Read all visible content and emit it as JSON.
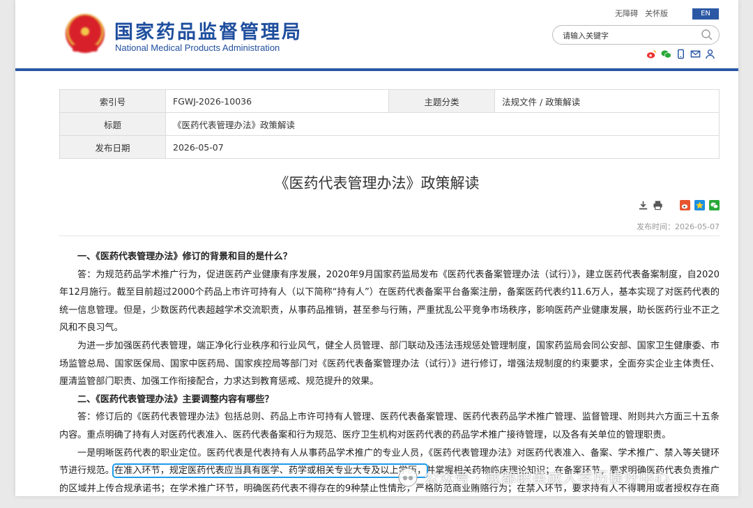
{
  "header": {
    "site_name_cn": "国家药品监督管理局",
    "site_name_en": "National Medical Products Administration",
    "top_links": [
      "无障碍",
      "关怀版"
    ],
    "top_button": "EN",
    "search_placeholder": "请输入关键字"
  },
  "meta": {
    "index_label": "索引号",
    "index_value": "FGWJ-2026-10036",
    "topic_label": "主题分类",
    "topic_value": "法规文件 / 政策解读",
    "title_label": "标题",
    "title_value": "《医药代表管理办法》政策解读",
    "date_label": "发布日期",
    "date_value": "2026-05-07"
  },
  "article": {
    "title": "《医药代表管理办法》政策解读",
    "publish_time": "发布时间：2026-05-07",
    "q1": "一、《医药代表管理办法》修订的背景和目的是什么？",
    "p1": "答：为规范药品学术推广行为，促进医药产业健康有序发展，2020年9月国家药监局发布《医药代表备案管理办法（试行）》，建立医药代表备案制度，自2020年12月施行。截至目前超过2000个药品上市许可持有人（以下简称“持有人”）在医药代表备案平台备案注册，备案医药代表约11.6万人，基本实现了对医药代表的统一信息管理。但是，少数医药代表超越学术交流职责，从事药品推销，甚至参与行贿，严重扰乱公平竞争市场秩序，影响医药产业健康发展，助长医药行业不正之风和不良习气。",
    "p2": "为进一步加强医药代表管理，端正净化行业秩序和行业风气，健全人员管理、部门联动及违法违规惩处管理制度，国家药监局会同公安部、国家卫生健康委、市场监管总局、国家医保局、国家中医药局、国家疾控局等部门对《医药代表备案管理办法（试行）》进行修订，增强法规制度的约束要求，全面夯实企业主体责任、厘清监管部门职责、加强工作衔接配合，力求达到教育惩戒、规范提升的效果。",
    "q2": "二、《医药代表管理办法》主要调整内容有哪些？",
    "p3": "答：修订后的《医药代表管理办法》包括总则、药品上市许可持有人管理、医药代表备案管理、医药代表药品学术推广管理、监督管理、附则共六方面三十五条内容。重点明确了持有人对医药代表准入、医药代表备案和行为规范、医疗卫生机构对医药代表的药品学术推广接待管理，以及各有关单位的管理职责。",
    "p4_a": "一是明晰医药代表的职业定位。医药代表是代表持有人从事药品学术推广的专业人员，《医药代表管理办法》对医药代表准入、备案、学术推广、禁入等关键环节进行规范。",
    "p4_highlight": "在准入环节，规定医药代表应当具有医学、药学或相关专业大专及以上学历，",
    "p4_b": "并掌握相关药物临床理论知识；在备案环节，要求明确医药代表负责推广的区域并上传合规承诺书；在学术推广环节，明确医药代表不得存在的9种禁止性情形，严格防范商业贿赂行为；在禁入环节，要求持有人不得聘用或者授权存在商业贿赂行为的医药代表，并根据合同追究相关人员和专业组织责任。"
  },
  "watermark": "公众号 · 成都职英成人学历提升中心",
  "colors": {
    "brand_blue": "#2b58a5",
    "highlight": "#1c9bea"
  }
}
